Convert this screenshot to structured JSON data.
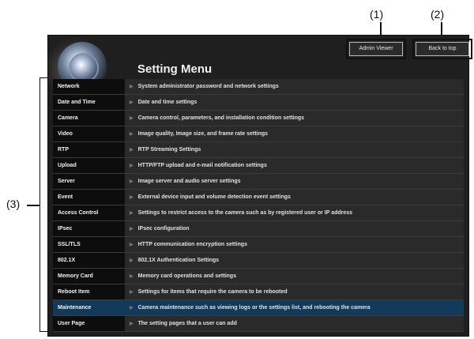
{
  "callouts": {
    "one": "(1)",
    "two": "(2)",
    "three": "(3)"
  },
  "header": {
    "title": "Setting Menu",
    "admin_viewer_label": "Admin Viewer",
    "back_to_top_label": "Back to top"
  },
  "menu": {
    "items": [
      {
        "label": "Network",
        "desc": "System administrator password and network settings"
      },
      {
        "label": "Date and Time",
        "desc": "Date and time settings"
      },
      {
        "label": "Camera",
        "desc": "Camera control, parameters, and installation condition settings"
      },
      {
        "label": "Video",
        "desc": "Image quality, Image size, and frame rate settings"
      },
      {
        "label": "RTP",
        "desc": "RTP Streaming Settings"
      },
      {
        "label": "Upload",
        "desc": "HTTP/FTP upload and e-mail notification settings"
      },
      {
        "label": "Server",
        "desc": "Image server and audio server settings"
      },
      {
        "label": "Event",
        "desc": "External device input and volume detection event settings"
      },
      {
        "label": "Access Control",
        "desc": "Settings to restrict access to the camera such as by registered user or IP address"
      },
      {
        "label": "IPsec",
        "desc": "IPsec configuration"
      },
      {
        "label": "SSL/TLS",
        "desc": "HTTP communication encryption settings"
      },
      {
        "label": "802.1X",
        "desc": "802.1X Authentication Settings"
      },
      {
        "label": "Memory Card",
        "desc": "Memory card operations and settings"
      },
      {
        "label": "Reboot Item",
        "desc": "Settings for items that require the camera to be rebooted"
      },
      {
        "label": "Maintenance",
        "desc": "Camera maintenance such as viewing logs or the settings list, and rebooting the camera"
      },
      {
        "label": "User Page",
        "desc": "The setting pages that a user can add"
      }
    ],
    "active_index": 14
  },
  "colors": {
    "screen_bg": "#1f1f1f",
    "active_row": "#123a5b"
  }
}
